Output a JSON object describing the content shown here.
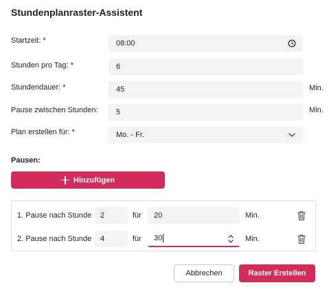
{
  "dialog": {
    "title": "Stundenplanraster-Assistent"
  },
  "form": {
    "start": {
      "label": "Startzeit: *",
      "value": "08:00",
      "icon": "clock-icon"
    },
    "hours_per_day": {
      "label": "Stunden pro Tag: *",
      "value": "6"
    },
    "lesson_duration": {
      "label": "Stundendauer: *",
      "value": "45",
      "unit": "Min."
    },
    "break_between": {
      "label": "Pause zwischen Stunden:",
      "value": "5",
      "unit": "Min."
    },
    "plan_for": {
      "label": "Plan erstellen für: *",
      "value": "Mo. - Fr.",
      "icon": "chevron-down-icon"
    }
  },
  "breaks": {
    "label": "Pausen:",
    "add_label": "Hinzufügen",
    "rows": [
      {
        "label": "1. Pause nach Stunde",
        "after": "2",
        "for_label": "für",
        "duration": "20",
        "unit": "Min."
      },
      {
        "label": "2. Pause nach Stunde",
        "after": "4",
        "for_label": "für",
        "duration": "30",
        "unit": "Min."
      }
    ]
  },
  "actions": {
    "cancel": "Abbrechen",
    "create": "Raster Erstellen"
  },
  "colors": {
    "accent": "#d12c5a",
    "field_bg": "#f3f3f3"
  }
}
